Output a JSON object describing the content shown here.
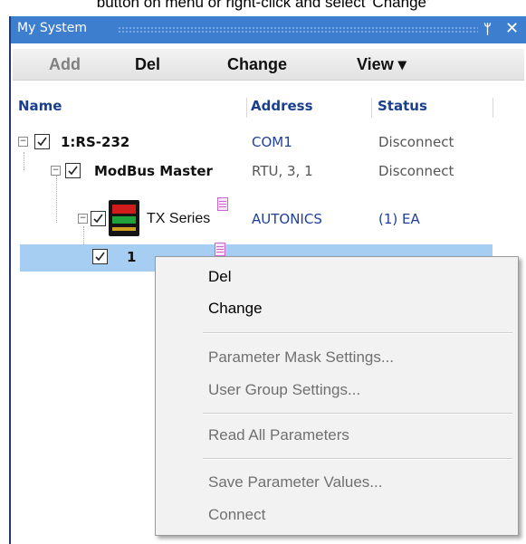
{
  "caption": "button on menu or right-click and select 'Change'",
  "panel": {
    "title": "My System",
    "pin_glyph": "ᛘ",
    "close_glyph": "✕"
  },
  "toolbar": {
    "add_label": "Add",
    "del_label": "Del",
    "change_label": "Change",
    "view_label": "View ▾"
  },
  "columns": {
    "name": "Name",
    "address": "Address",
    "status": "Status"
  },
  "tree": [
    {
      "name": "1:RS-232",
      "address": "COM1",
      "status": "Disconnect",
      "checked": true
    },
    {
      "name": "ModBus Master",
      "address": "RTU, 3, 1",
      "status": "Disconnect",
      "checked": true
    },
    {
      "name": "TX Series",
      "address": "AUTONICS",
      "status": "(1) EA",
      "checked": true
    },
    {
      "name": "1",
      "address": "",
      "status": "",
      "checked": true,
      "selected": true
    }
  ],
  "context_menu": {
    "items": [
      {
        "label": "Del",
        "enabled": true
      },
      {
        "label": "Change",
        "enabled": true
      },
      {
        "label": "Parameter Mask Settings...",
        "enabled": false
      },
      {
        "label": "User Group Settings...",
        "enabled": false
      },
      {
        "label": "Read All Parameters",
        "enabled": false
      },
      {
        "label": "Save Parameter Values...",
        "enabled": false
      },
      {
        "label": "Connect",
        "enabled": false
      }
    ]
  },
  "colors": {
    "titlebar": "#3d7fce",
    "selection": "#a6cdf2",
    "column_header_text": "#1a3f8e"
  }
}
